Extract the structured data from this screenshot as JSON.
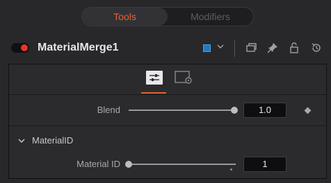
{
  "tabs": [
    {
      "label": "Tools",
      "active": true
    },
    {
      "label": "Modifiers",
      "active": false
    }
  ],
  "node": {
    "title": "MaterialMerge1",
    "enabled": true,
    "color_swatch": "#1f7ac4",
    "header_icons": [
      "window-icon",
      "pin-icon",
      "lock-icon",
      "reset-icon"
    ]
  },
  "subtabs": [
    {
      "icon": "sliders-icon",
      "active": true
    },
    {
      "icon": "settings-icon",
      "active": false
    }
  ],
  "controls": {
    "blend": {
      "label": "Blend",
      "value": "1.0",
      "fraction": 1.0
    },
    "material_id_group": {
      "label": "MaterialID",
      "expanded": true
    },
    "material_id": {
      "label": "Material ID",
      "value": "1",
      "fraction": 0.0
    }
  },
  "colors": {
    "accent": "#e8612f",
    "toggle_on": "#e8342a"
  }
}
